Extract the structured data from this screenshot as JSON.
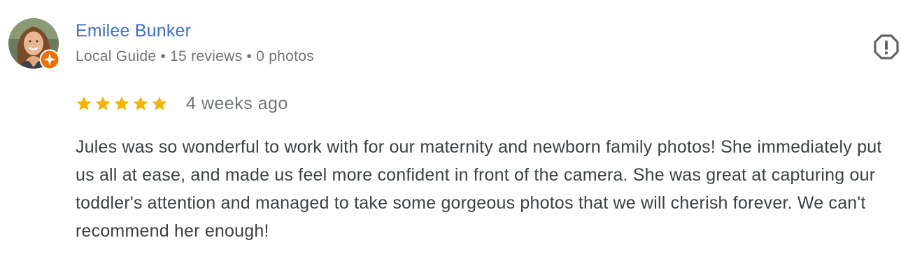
{
  "reviewer": {
    "name": "Emilee Bunker",
    "badge": "Local Guide",
    "reviews": "15 reviews",
    "photos": "0 photos",
    "separator": "•"
  },
  "rating": {
    "stars": 5,
    "max_stars": 5,
    "star_color": "#f4b400",
    "time_ago": "4 weeks ago"
  },
  "review_text": "Jules was so wonderful to work with for our maternity and newborn family photos! She immediately put us all at ease, and made us feel more confident in front of the camera. She was great at capturing our toddler's attention and managed to take some gorgeous photos that we will cherish forever. We can't recommend her enough!",
  "icons": {
    "avatar": "profile-photo",
    "badge": "local-guide-star-icon",
    "report": "report-icon"
  },
  "colors": {
    "name": "#3b6fd6",
    "meta": "#70757a",
    "body_text": "#3c4043",
    "guide_badge": "#e8710a"
  }
}
